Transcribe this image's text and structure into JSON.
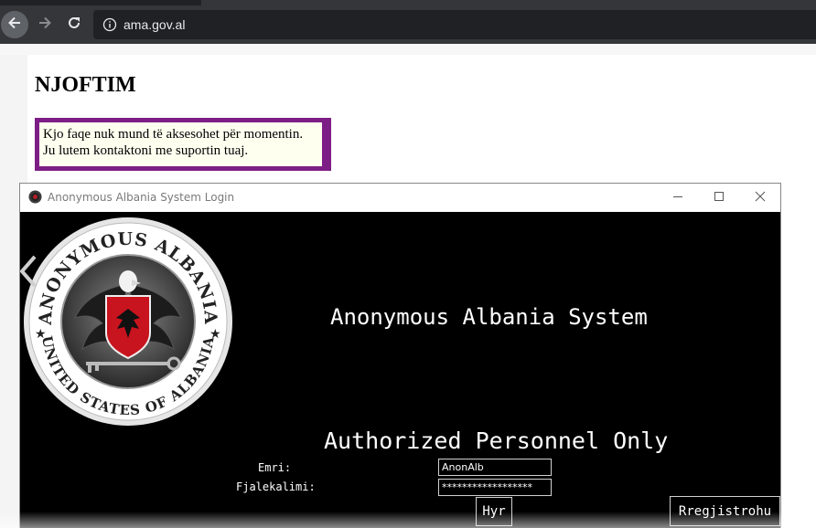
{
  "browser": {
    "url": "ama.gov.al",
    "back_icon": "arrow-left-icon",
    "forward_icon": "arrow-right-icon",
    "reload_icon": "reload-icon",
    "info_icon": "info-icon"
  },
  "page": {
    "title": "NJOFTIM",
    "notice_lines": [
      "Kjo faqe nuk mund të aksesohet për momentin.",
      "Ju lutem kontaktoni me suportin tuaj."
    ],
    "notice_border_color": "#7d1e86"
  },
  "login_window": {
    "title": "Anonymous Albania System Login",
    "emblem": {
      "top_text": "ANONYMOUS ALBANIA",
      "bottom_text": "UNITED STATES OF ALBANIA"
    },
    "system_title": "Anonymous Albania System",
    "subtitle": "Authorized Personnel Only",
    "username_label": "Emri:",
    "username_value": "AnonAlb",
    "password_label": "Fjalekalimi:",
    "password_value": "******************",
    "login_button": "Hyr",
    "register_button": "Rregjistrohu"
  }
}
